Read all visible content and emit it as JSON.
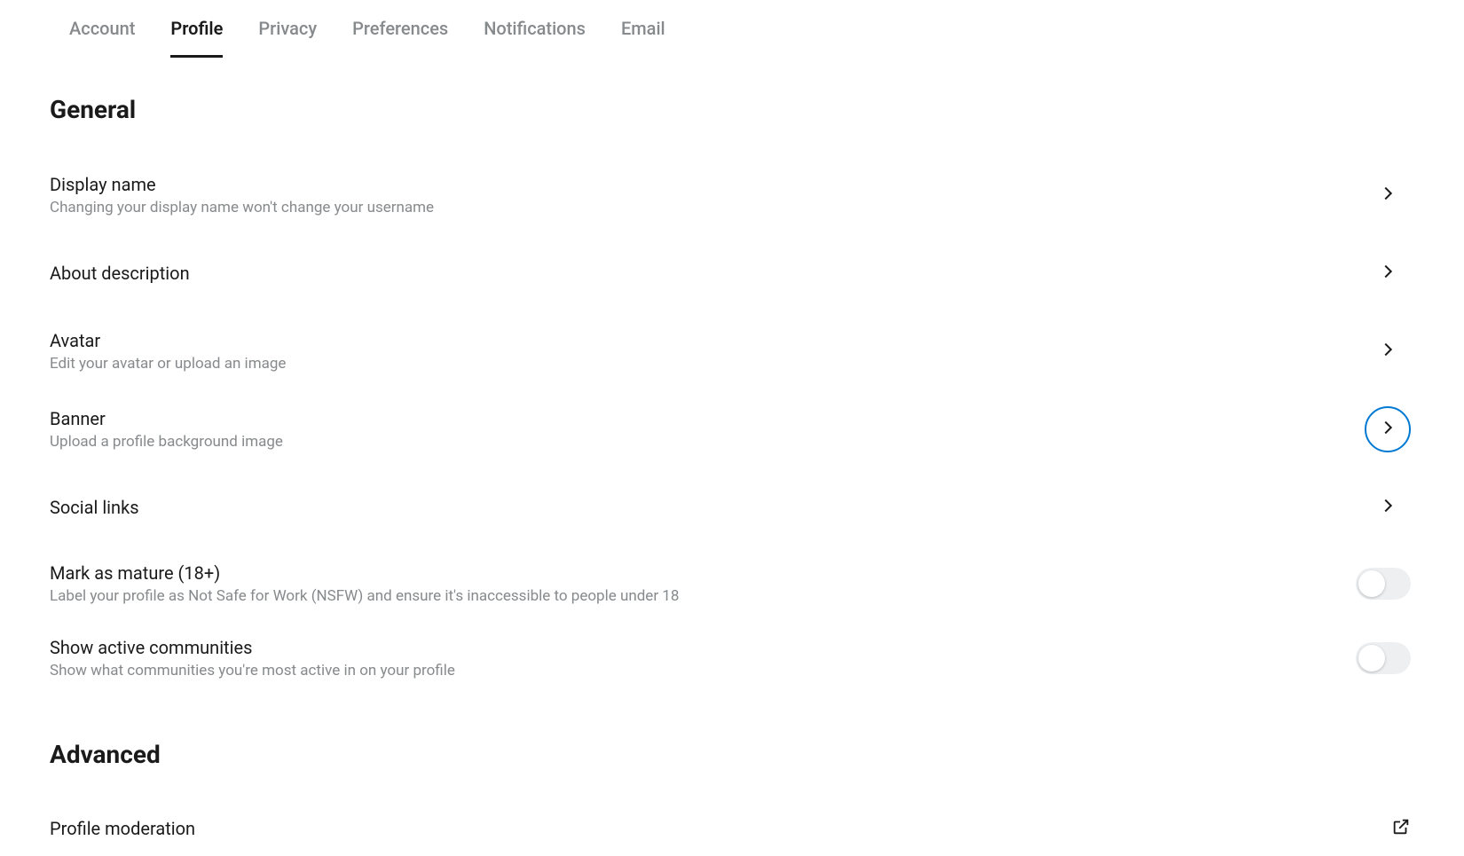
{
  "tabs": {
    "account": "Account",
    "profile": "Profile",
    "privacy": "Privacy",
    "preferences": "Preferences",
    "notifications": "Notifications",
    "email": "Email"
  },
  "sections": {
    "general_title": "General",
    "advanced_title": "Advanced"
  },
  "settings": {
    "display_name": {
      "label": "Display name",
      "desc": "Changing your display name won't change your username"
    },
    "about": {
      "label": "About description"
    },
    "avatar": {
      "label": "Avatar",
      "desc": "Edit your avatar or upload an image"
    },
    "banner": {
      "label": "Banner",
      "desc": "Upload a profile background image"
    },
    "social": {
      "label": "Social links"
    },
    "mature": {
      "label": "Mark as mature (18+)",
      "desc": "Label your profile as Not Safe for Work (NSFW) and ensure it's inaccessible to people under 18"
    },
    "active_communities": {
      "label": "Show active communities",
      "desc": "Show what communities you're most active in on your profile"
    },
    "profile_moderation": {
      "label": "Profile moderation"
    }
  }
}
